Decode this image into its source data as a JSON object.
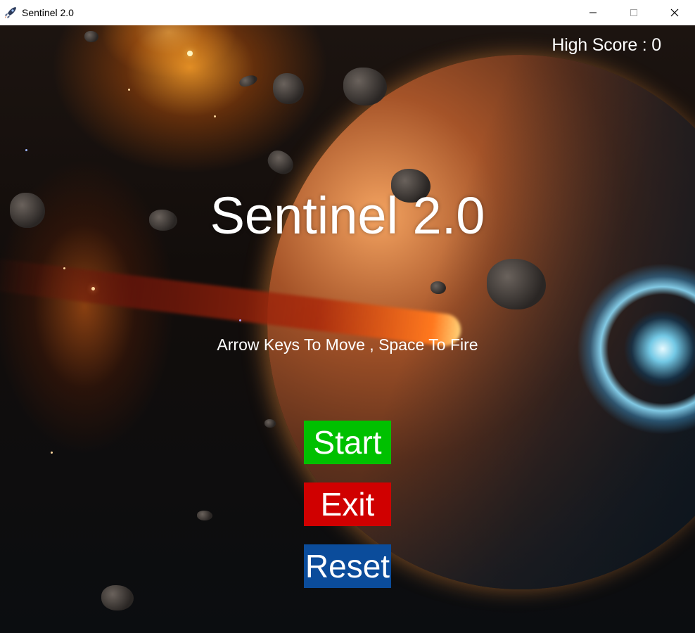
{
  "window": {
    "title": "Sentinel 2.0",
    "controls": {
      "minimize_icon": "minimize-icon",
      "maximize_icon": "maximize-icon",
      "close_icon": "close-icon"
    }
  },
  "game": {
    "high_score_text": "High Score : 0",
    "title": "Sentinel 2.0",
    "instructions": "Arrow Keys To Move , Space To Fire",
    "buttons": {
      "start": {
        "label": "Start",
        "color": "#00c000"
      },
      "exit": {
        "label": "Exit",
        "color": "#d00000"
      },
      "reset": {
        "label": "Reset",
        "color": "#0b4c9b"
      }
    }
  },
  "colors": {
    "text": "#ffffff",
    "titlebar": "#ffffff"
  }
}
